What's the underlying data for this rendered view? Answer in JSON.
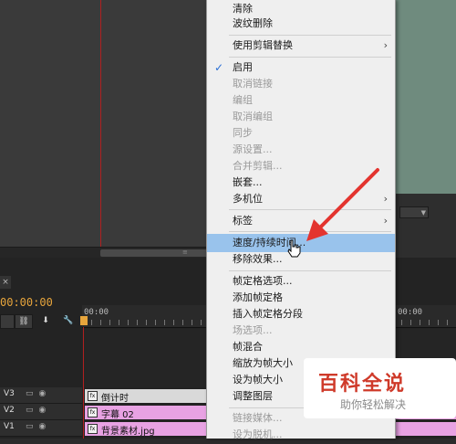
{
  "menu": {
    "items": [
      {
        "label": "清除",
        "disabled": false
      },
      {
        "label": "波纹删除",
        "disabled": false
      },
      {
        "label": "使用剪辑替换",
        "disabled": false,
        "submenu": true
      },
      {
        "label": "启用",
        "disabled": false,
        "checked": true
      },
      {
        "label": "取消链接",
        "disabled": true
      },
      {
        "label": "编组",
        "disabled": true
      },
      {
        "label": "取消编组",
        "disabled": true
      },
      {
        "label": "同步",
        "disabled": true
      },
      {
        "label": "源设置...",
        "disabled": true
      },
      {
        "label": "合并剪辑...",
        "disabled": true
      },
      {
        "label": "嵌套...",
        "disabled": false
      },
      {
        "label": "多机位",
        "disabled": false,
        "submenu": true
      },
      {
        "label": "标签",
        "disabled": false,
        "submenu": true
      },
      {
        "label": "速度/持续时间...",
        "disabled": false,
        "highlighted": true
      },
      {
        "label": "移除效果...",
        "disabled": false
      },
      {
        "label": "帧定格选项...",
        "disabled": false
      },
      {
        "label": "添加帧定格",
        "disabled": false
      },
      {
        "label": "插入帧定格分段",
        "disabled": false
      },
      {
        "label": "场选项...",
        "disabled": true
      },
      {
        "label": "帧混合",
        "disabled": false
      },
      {
        "label": "缩放为帧大小",
        "disabled": false
      },
      {
        "label": "设为帧大小",
        "disabled": false
      },
      {
        "label": "调整图层",
        "disabled": false
      },
      {
        "label": "链接媒体...",
        "disabled": true
      },
      {
        "label": "设为脱机...",
        "disabled": true
      }
    ],
    "check_mark": "✓",
    "submenu_arrow": "›"
  },
  "timeline": {
    "tab_close": "×",
    "timecode": "00:00:00",
    "ruler_start": "00:00",
    "ruler_end": "00:00",
    "tracks": [
      {
        "name": "V3",
        "clip_label": "倒计时"
      },
      {
        "name": "V2",
        "clip_label": "字幕 02"
      },
      {
        "name": "V1",
        "clip_label": "背景素材.jpg"
      }
    ],
    "fx_badge": "fx",
    "colors": {
      "timecode": "#e7a53c",
      "clip_pink": "#e8a2e3",
      "clip_gray": "#d9d9d9",
      "highlight": "#99c3ec"
    }
  },
  "watermark": {
    "title": "百科全说",
    "subtitle": "助你轻松解决"
  }
}
